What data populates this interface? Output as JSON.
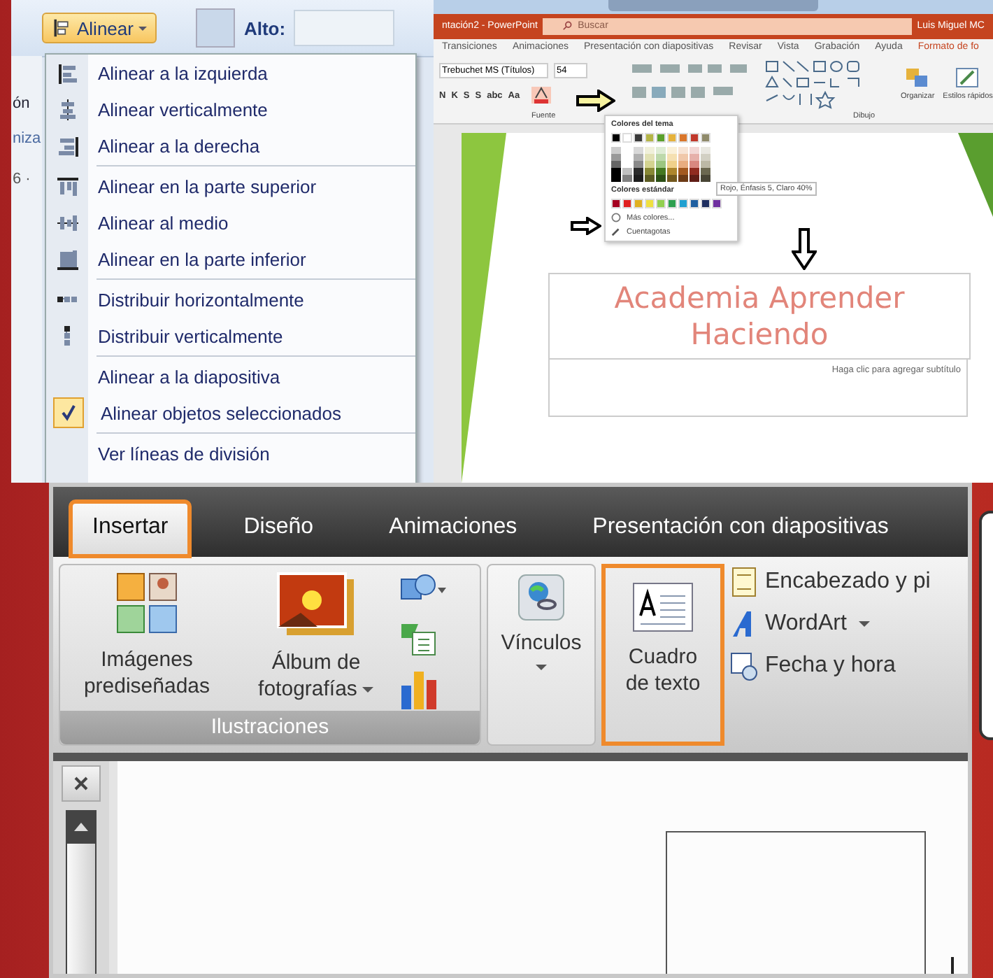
{
  "alinear_panel": {
    "button": "Alinear",
    "height_label": "Alto:",
    "cut_labels": [
      "ón",
      "niza",
      "6 ·"
    ],
    "menu": {
      "groups": [
        [
          {
            "label": "Alinear a la izquierda",
            "checked": false
          },
          {
            "label": "Alinear verticalmente",
            "checked": false
          },
          {
            "label": "Alinear a la derecha",
            "checked": false
          }
        ],
        [
          {
            "label": "Alinear en la parte superior",
            "checked": false
          },
          {
            "label": "Alinear al medio",
            "checked": false
          },
          {
            "label": "Alinear en la parte inferior",
            "checked": false
          }
        ],
        [
          {
            "label": "Distribuir horizontalmente",
            "checked": false
          },
          {
            "label": "Distribuir verticalmente",
            "checked": false
          }
        ],
        [
          {
            "label": "Alinear a la diapositiva",
            "checked": false
          },
          {
            "label": "Alinear objetos seleccionados",
            "checked": true
          }
        ],
        [
          {
            "label": "Ver líneas de división",
            "checked": false
          }
        ]
      ]
    }
  },
  "powerpoint_panel": {
    "title": "ntación2 - PowerPoint",
    "search": {
      "placeholder": "Buscar"
    },
    "user": "Luis Miguel MC",
    "tabs": [
      "Transiciones",
      "Animaciones",
      "Presentación con diapositivas",
      "Revisar",
      "Vista",
      "Grabación",
      "Ayuda",
      "Formato de fo"
    ],
    "font_name": "Trebuchet MS (Títulos)",
    "font_size": "54",
    "format_buttons": [
      "N",
      "K",
      "S",
      "S",
      "abc",
      "Aa"
    ],
    "group_labels": [
      "Fuente",
      "Dibujo"
    ],
    "drawing_commands": [
      "Organizar",
      "Estilos rápidos"
    ],
    "color_picker": {
      "theme_heading": "Colores del tema",
      "theme_colors": [
        {
          "color": "#000000"
        },
        {
          "color": "#ffffff"
        },
        {
          "color": "#3a3a3a"
        },
        {
          "color": "#b5b546"
        },
        {
          "color": "#5aa02c"
        },
        {
          "color": "#e6b23c"
        },
        {
          "color": "#d9762b"
        },
        {
          "color": "#c0392b"
        },
        {
          "color": "#8f8a6a"
        }
      ],
      "tooltip": "Rojo, Énfasis 5, Claro 40%",
      "standard_heading": "Colores estándar",
      "standard_colors": [
        {
          "color": "#a50021"
        },
        {
          "color": "#e02020"
        },
        {
          "color": "#e0b020"
        },
        {
          "color": "#f0e040"
        },
        {
          "color": "#92d050"
        },
        {
          "color": "#2ea050"
        },
        {
          "color": "#20a0d0"
        },
        {
          "color": "#1f5fa0"
        },
        {
          "color": "#1f2f60"
        },
        {
          "color": "#7030a0"
        }
      ],
      "more_colors": "Más colores...",
      "eyedropper": "Cuentagotas"
    },
    "slide": {
      "title": "Academia Aprender Haciendo",
      "subtitle_placeholder": "Haga clic para agregar subtítulo"
    }
  },
  "ribbon_panel": {
    "tabs": [
      {
        "label": "Insertar",
        "selected": true,
        "highlighted": true
      },
      {
        "label": "Diseño",
        "selected": false,
        "highlighted": false
      },
      {
        "label": "Animaciones",
        "selected": false,
        "highlighted": false
      },
      {
        "label": "Presentación con diapositivas",
        "selected": false,
        "highlighted": false
      }
    ],
    "illustrations": {
      "label": "Ilustraciones",
      "commands": [
        {
          "kind": "clipart",
          "label": "Imágenes prediseñadas",
          "dropdown": false
        },
        {
          "kind": "album",
          "label": "Álbum de fotografías",
          "dropdown": true
        }
      ]
    },
    "links": {
      "label": "Vínculos",
      "dropdown": true
    },
    "text_box": {
      "label": "Cuadro de texto",
      "highlighted": true
    },
    "small_commands": [
      {
        "label": "Encabezado y pi",
        "dropdown": false
      },
      {
        "label": "WordArt",
        "dropdown": true
      },
      {
        "label": "Fecha y hora",
        "dropdown": false
      }
    ]
  }
}
